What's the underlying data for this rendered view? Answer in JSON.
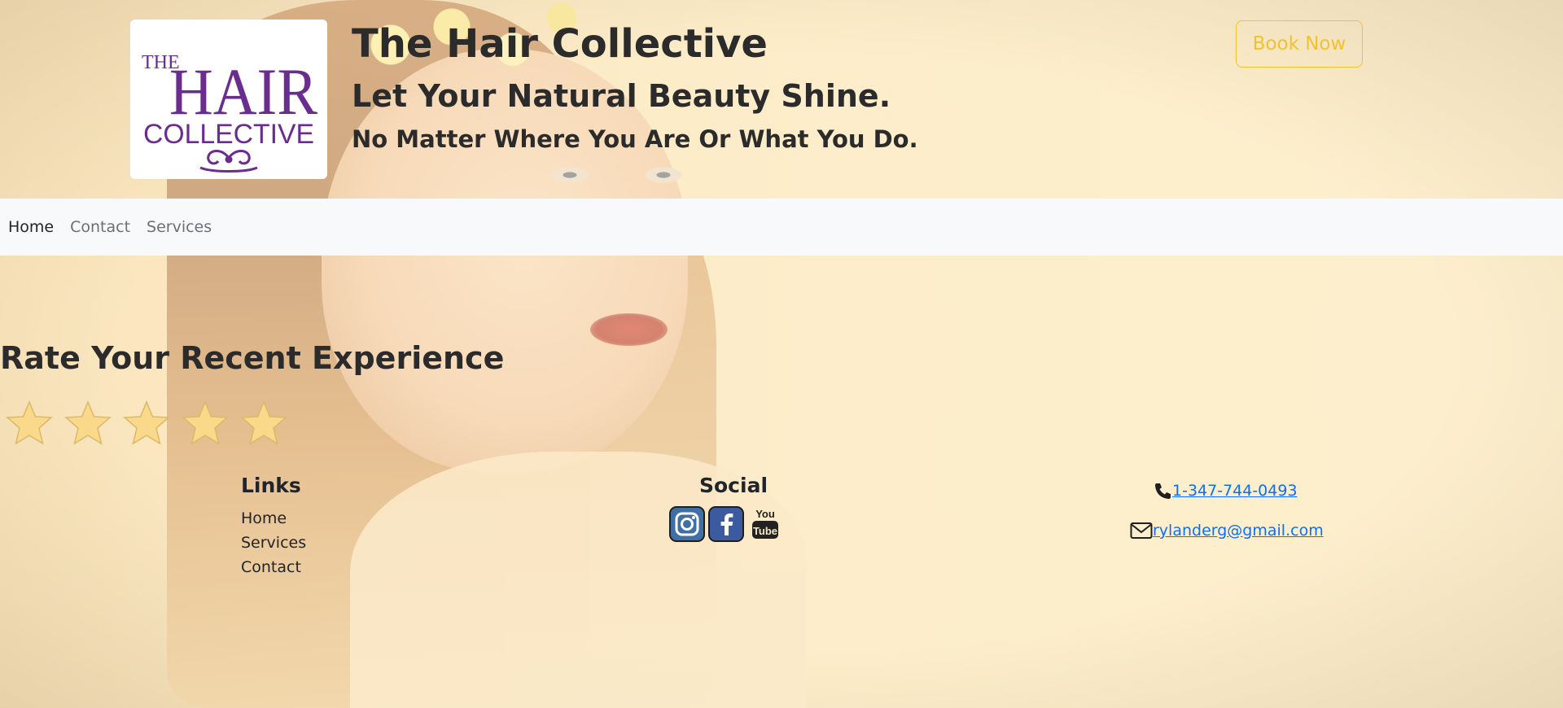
{
  "header": {
    "logo_text": {
      "line1": "THE",
      "line2": "HAIR",
      "line3": "COLLECTIVE"
    },
    "site_title": "The Hair Collective",
    "tagline": "Let Your Natural Beauty Shine.",
    "sub_tagline": "No Matter Where You Are Or What You Do.",
    "book_button": "Book Now"
  },
  "nav": {
    "items": [
      {
        "label": "Home",
        "active": true
      },
      {
        "label": "Contact",
        "active": false
      },
      {
        "label": "Services",
        "active": false
      }
    ]
  },
  "rating": {
    "title": "Rate Your Recent Experience",
    "star_count": 5,
    "selected": 0
  },
  "footer": {
    "links_title": "Links",
    "links": [
      "Home",
      "Services",
      "Contact"
    ],
    "social_title": "Social",
    "social_icons": [
      "instagram-icon",
      "facebook-icon",
      "youtube-icon"
    ],
    "youtube_text": {
      "top": "You",
      "bottom": "Tube"
    },
    "phone": " 1-347-744-0493",
    "email": " rylanderg@gmail.com"
  },
  "colors": {
    "accent": "#f2c230",
    "brand_purple": "#6a2c8e",
    "link": "#0d6efd",
    "nav_bg": "#f8f9fa"
  }
}
